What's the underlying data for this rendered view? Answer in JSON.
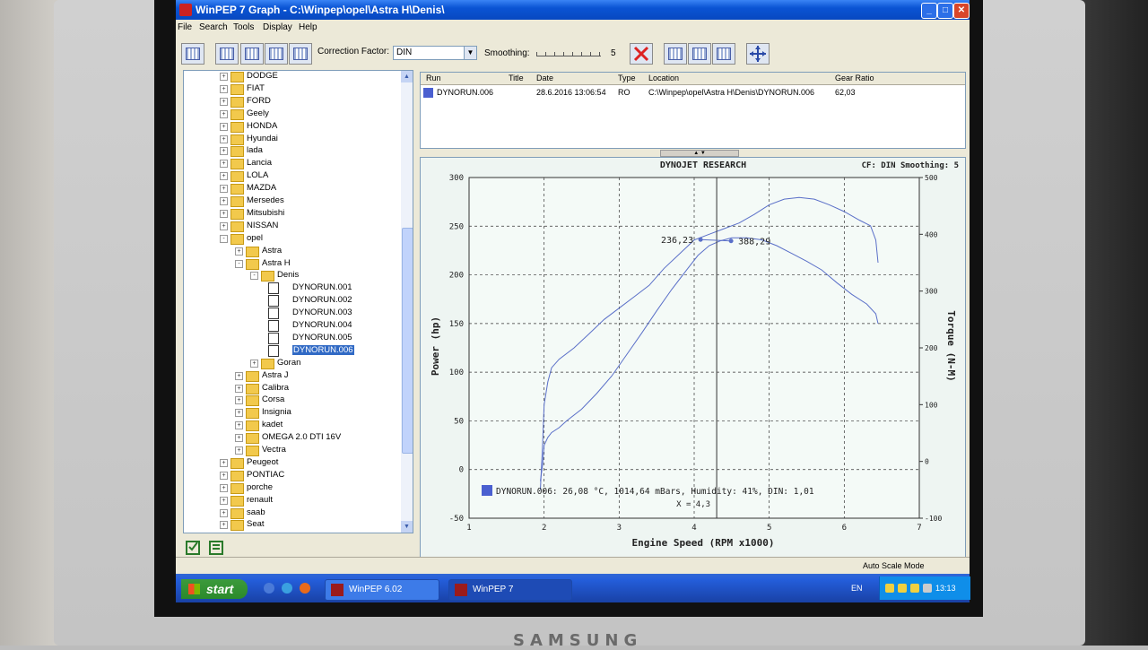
{
  "window": {
    "title": "WinPEP 7   Graph - C:\\Winpep\\opel\\Astra H\\Denis\\"
  },
  "menu": [
    "File",
    "Search",
    "Tools",
    "Display",
    "Help"
  ],
  "toolbar": {
    "correction_label": "Correction Factor:",
    "correction_value": "DIN",
    "smoothing_label": "Smoothing:",
    "smoothing_value": "5"
  },
  "tree": [
    {
      "level": 1,
      "label": "DODGE",
      "exp": "+"
    },
    {
      "level": 1,
      "label": "FIAT",
      "exp": "+"
    },
    {
      "level": 1,
      "label": "FORD",
      "exp": "+"
    },
    {
      "level": 1,
      "label": "Geely",
      "exp": "+"
    },
    {
      "level": 1,
      "label": "HONDA",
      "exp": "+"
    },
    {
      "level": 1,
      "label": "Hyundai",
      "exp": "+"
    },
    {
      "level": 1,
      "label": "lada",
      "exp": "+"
    },
    {
      "level": 1,
      "label": "Lancia",
      "exp": "+"
    },
    {
      "level": 1,
      "label": "LOLA",
      "exp": "+"
    },
    {
      "level": 1,
      "label": "MAZDA",
      "exp": "+"
    },
    {
      "level": 1,
      "label": "Mersedes",
      "exp": "+"
    },
    {
      "level": 1,
      "label": "Mitsubishi",
      "exp": "+"
    },
    {
      "level": 1,
      "label": "NISSAN",
      "exp": "+"
    },
    {
      "level": 1,
      "label": "opel",
      "exp": "-"
    },
    {
      "level": 2,
      "label": "Astra",
      "exp": "+"
    },
    {
      "level": 2,
      "label": "Astra H",
      "exp": "-"
    },
    {
      "level": 3,
      "label": "Denis",
      "exp": "-"
    },
    {
      "level": 4,
      "label": "DYNORUN.001",
      "file": true
    },
    {
      "level": 4,
      "label": "DYNORUN.002",
      "file": true
    },
    {
      "level": 4,
      "label": "DYNORUN.003",
      "file": true
    },
    {
      "level": 4,
      "label": "DYNORUN.004",
      "file": true
    },
    {
      "level": 4,
      "label": "DYNORUN.005",
      "file": true
    },
    {
      "level": 4,
      "label": "DYNORUN.006",
      "file": true,
      "selected": true
    },
    {
      "level": 3,
      "label": "Goran",
      "exp": "+"
    },
    {
      "level": 2,
      "label": "Astra J",
      "exp": "+"
    },
    {
      "level": 2,
      "label": "Calibra",
      "exp": "+"
    },
    {
      "level": 2,
      "label": "Corsa",
      "exp": "+"
    },
    {
      "level": 2,
      "label": "Insignia",
      "exp": "+"
    },
    {
      "level": 2,
      "label": "kadet",
      "exp": "+"
    },
    {
      "level": 2,
      "label": "OMEGA 2.0 DTI 16V",
      "exp": "+"
    },
    {
      "level": 2,
      "label": "Vectra",
      "exp": "+"
    },
    {
      "level": 1,
      "label": "Peugeot",
      "exp": "+"
    },
    {
      "level": 1,
      "label": "PONTIAC",
      "exp": "+"
    },
    {
      "level": 1,
      "label": "porche",
      "exp": "+"
    },
    {
      "level": 1,
      "label": "renault",
      "exp": "+"
    },
    {
      "level": 1,
      "label": "saab",
      "exp": "+"
    },
    {
      "level": 1,
      "label": "Seat",
      "exp": "+"
    }
  ],
  "runs": {
    "headers": [
      "Run",
      "Title",
      "Date",
      "Type",
      "Location",
      "Gear Ratio"
    ],
    "rows": [
      [
        "DYNORUN.006",
        "",
        "28.6.2016 13:06:54",
        "RO",
        "C:\\Winpep\\opel\\Astra H\\Denis\\DYNORUN.006",
        "62,03"
      ]
    ]
  },
  "chart_data": {
    "type": "line",
    "title": "DYNOJET RESEARCH",
    "info": "CF: DIN  Smoothing: 5",
    "xlabel": "Engine Speed (RPM x1000)",
    "ylabel": "Power (hp)",
    "y2label": "Torque (N-M)",
    "xlim": [
      1,
      7
    ],
    "ylim": [
      -50,
      300
    ],
    "y2lim": [
      -100,
      500
    ],
    "x_ticks": [
      "1",
      "2",
      "3",
      "4",
      "5",
      "6",
      "7"
    ],
    "y_ticks": [
      "-50",
      "0",
      "50",
      "100",
      "150",
      "200",
      "250",
      "300"
    ],
    "y2_ticks": [
      "-100",
      "0",
      "100",
      "200",
      "300",
      "400",
      "500"
    ],
    "grid": true,
    "series": [
      {
        "name": "Power",
        "axis": "y",
        "color": "#5a6fc8",
        "x": [
          1.95,
          1.98,
          2.0,
          2.05,
          2.1,
          2.2,
          2.3,
          2.5,
          2.7,
          2.9,
          3.1,
          3.3,
          3.5,
          3.7,
          3.9,
          4.05,
          4.2,
          4.35,
          4.5,
          4.7,
          4.9,
          5.1,
          5.3,
          5.5,
          5.7,
          5.9,
          6.1,
          6.3,
          6.42,
          6.45
        ],
        "y": [
          -12,
          5,
          25,
          33,
          38,
          43,
          50,
          62,
          78,
          96,
          118,
          140,
          163,
          185,
          205,
          220,
          230,
          235,
          238,
          238,
          236,
          230,
          222,
          214,
          205,
          192,
          180,
          170,
          160,
          150
        ]
      },
      {
        "name": "Torque",
        "axis": "y2",
        "color": "#5a6fc8",
        "x": [
          1.95,
          1.98,
          2.0,
          2.05,
          2.1,
          2.2,
          2.4,
          2.6,
          2.8,
          3.0,
          3.2,
          3.4,
          3.6,
          3.8,
          4.0,
          4.2,
          4.4,
          4.6,
          4.8,
          5.0,
          5.2,
          5.4,
          5.6,
          5.8,
          6.0,
          6.2,
          6.35,
          6.42,
          6.45
        ],
        "y": [
          -50,
          30,
          100,
          140,
          165,
          180,
          200,
          225,
          250,
          270,
          290,
          310,
          340,
          365,
          390,
          400,
          410,
          420,
          435,
          452,
          462,
          465,
          462,
          452,
          440,
          425,
          415,
          390,
          350
        ]
      }
    ],
    "cursor": {
      "x": 4.3,
      "x_label": "X = 4,3",
      "power_label": "236,23",
      "torque_label": "388,29"
    },
    "legend_text": "DYNORUN.006: 26,08 °C, 1014,64 mBars, Humidity: 41%, DIN: 1,01",
    "legend": "bottom-left"
  },
  "statusbar": {
    "mode": "Auto Scale Mode"
  },
  "taskbar": {
    "start": "start",
    "tasks": [
      "WinPEP 6.02",
      "WinPEP 7"
    ],
    "lang": "EN",
    "clock": "13:13"
  },
  "monitor": {
    "brand": "SAMSUNG"
  }
}
